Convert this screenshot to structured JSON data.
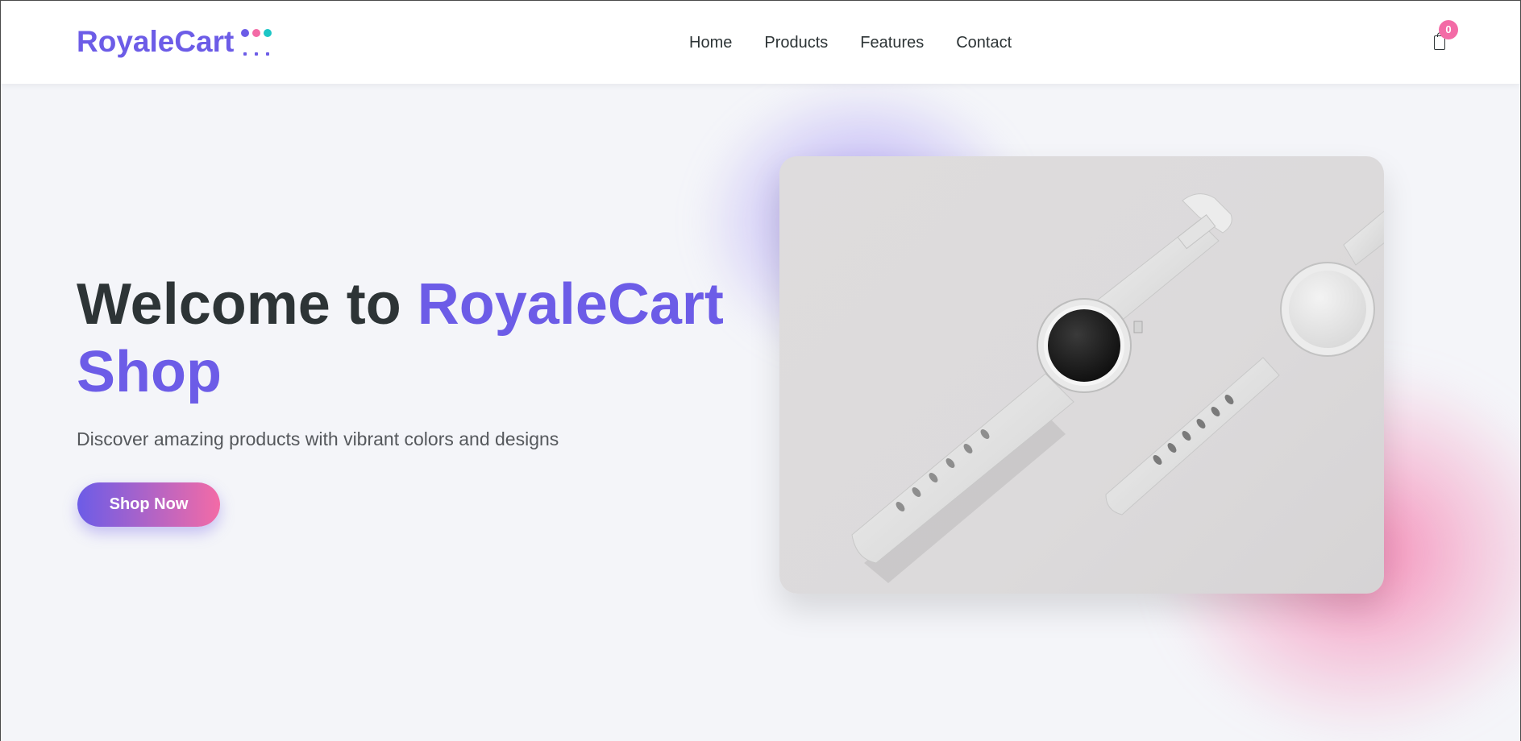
{
  "brand": {
    "name": "RoyaleCart",
    "colors": {
      "primary": "#6c5ce7",
      "accent": "#f36ba6",
      "teal": "#1cc6c6"
    }
  },
  "nav": {
    "items": [
      {
        "label": "Home"
      },
      {
        "label": "Products"
      },
      {
        "label": "Features"
      },
      {
        "label": "Contact"
      }
    ]
  },
  "cart": {
    "icon": "shopping-bag-icon",
    "count": "0"
  },
  "hero": {
    "title_prefix": "Welcome to ",
    "title_accent": "RoyaleCart Shop",
    "subtitle": "Discover amazing products with vibrant colors and designs",
    "cta_label": "Shop Now"
  }
}
